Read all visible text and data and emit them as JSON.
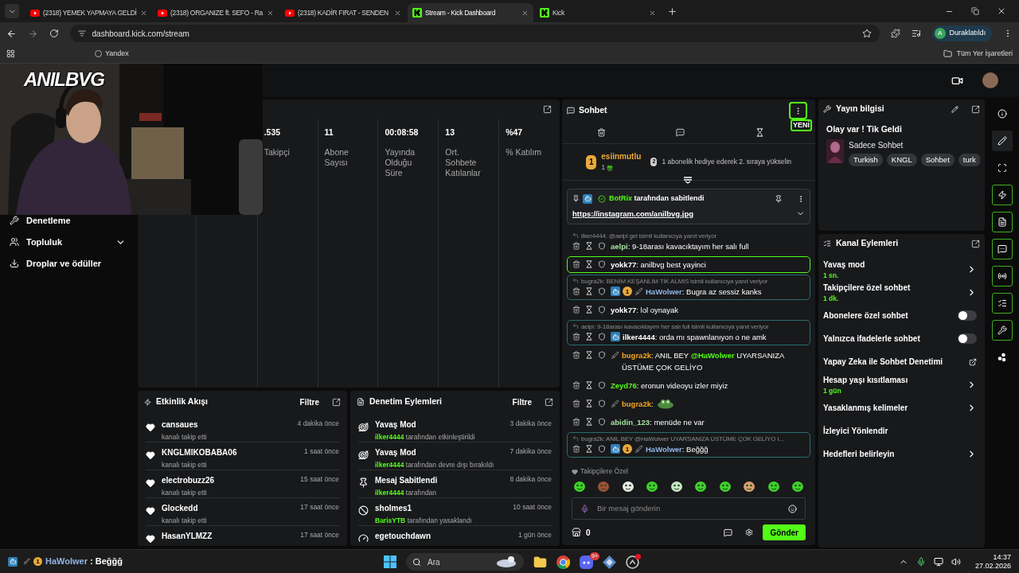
{
  "browser": {
    "tabs": [
      {
        "title": "(2318) YEMEK YAPMAYA GELDİ",
        "kind": "youtube",
        "selected": false
      },
      {
        "title": "(2318) ORGANIZE ft. SEFO - Ra",
        "kind": "youtube",
        "selected": false
      },
      {
        "title": "(2318) KADİR FIRAT - SENDEN",
        "kind": "youtube",
        "selected": false
      },
      {
        "title": "Stream - Kick Dashboard",
        "kind": "kick",
        "selected": true
      },
      {
        "title": "Kick",
        "kind": "kick",
        "selected": false
      }
    ],
    "url": "dashboard.kick.com/stream",
    "profile": {
      "initial": "A",
      "status": "Duraklatıldı"
    },
    "bookmarks": [
      "Yandex"
    ],
    "all_bookmarks": "Tüm Yer İşaretleri"
  },
  "overlay": {
    "logo": "ANILBVG",
    "chat_line": {
      "badge": "1",
      "user": "HaWolwer",
      "separator": ":",
      "text": "Beğğğ"
    }
  },
  "sidebar": {
    "items": [
      {
        "label": "Denetleme",
        "kind": "link"
      },
      {
        "label": "Topluluk",
        "kind": "expandable"
      },
      {
        "label": "Droplar ve ödüller",
        "kind": "link"
      }
    ]
  },
  "stats": [
    {
      "value": ".535",
      "label": "Takipçi"
    },
    {
      "value": "11",
      "label": "Abone Sayısı"
    },
    {
      "value": "00:08:58",
      "label": "Yayında Olduğu Süre"
    },
    {
      "value": "13",
      "label": "Ort. Sohbete Katılanlar"
    },
    {
      "value": "%47",
      "label": "% Katılım"
    }
  ],
  "activity_feed": {
    "title": "Etkinlik Akışı",
    "filter": "Filtre",
    "items": [
      {
        "name": "cansaues",
        "detail": "kanalı takip etti",
        "time": "4 dakika önce"
      },
      {
        "name": "KNGLMIKOBABA06",
        "detail": "kanalı takip etti",
        "time": "1 saat önce"
      },
      {
        "name": "electrobuzz26",
        "detail": "kanalı takip etti",
        "time": "15 saat önce"
      },
      {
        "name": "Glockedd",
        "detail": "kanalı takip etti",
        "time": "17 saat önce"
      },
      {
        "name": "HasanYLMZZ",
        "time": "17 saat önce"
      }
    ]
  },
  "moderation_log": {
    "title": "Denetim Eylemleri",
    "filter": "Filtre",
    "items": [
      {
        "kind": "slow",
        "title": "Yavaş Mod",
        "user": "ilker4444",
        "action": "tarafından etkinleştirildi",
        "time": "3 dakika önce"
      },
      {
        "kind": "slow",
        "title": "Yavaş Mod",
        "user": "ilker4444",
        "action": "tarafından devre dışı bırakıldı",
        "time": "7 dakika önce"
      },
      {
        "kind": "pin",
        "title": "Mesaj Sabitlendi",
        "user": "ilker4444",
        "action": "tarafından",
        "time": "8 dakika önce"
      },
      {
        "kind": "ban",
        "title": "sholmes1",
        "user": "BarisYTB",
        "action": "tarafından yasaklandı",
        "time": "10 saat önce"
      },
      {
        "kind": "gauge",
        "title": "egetouchdawn",
        "time": "1 gün önce"
      }
    ]
  },
  "chat": {
    "title": "Sohbet",
    "new_label": "YENİ",
    "separator": ":",
    "leader": {
      "rank": "1",
      "name": "esiinmutlu",
      "gifts": "1",
      "next_rank": "2",
      "hint": "1 abonelik hediye ederek 2. sıraya yükselin"
    },
    "pinned": {
      "user": "BotRix",
      "by": "tarafından sabitlendi",
      "link": "https://instagram.com/anilbvg.jpg"
    },
    "messages": [
      {
        "kind": "plain",
        "reply_to": "ilker4444: @aelpi gel isimli kullanıcıya yanıt veriyor",
        "user": "aelpi",
        "color": "#a6e3a1",
        "text": "9-18arası kavacıktayım her salı full"
      },
      {
        "kind": "highlighted",
        "user": "yokk77",
        "color": "#ffffff",
        "text": "anilbvg best yayinci"
      },
      {
        "kind": "reply",
        "reply_to": "bugra2k: BENİM KEŞANLIM TİK ALMIS isimli kullanıcıya yanıt veriyor",
        "badges": [
          {
            "kind": "bot"
          },
          {
            "kind": "sub",
            "label": "1"
          },
          {
            "kind": "sword"
          }
        ],
        "user": "HaWolwer",
        "color": "#8fb4e6",
        "text": "Bugra az sessiz kanks"
      },
      {
        "kind": "plain",
        "user": "yokk77",
        "color": "#ffffff",
        "text": "lol oynayak"
      },
      {
        "kind": "reply",
        "reply_to": "aelpi: 9-18arası kavacıktayım her salı full isimli kullanıcıya yanıt veriyor",
        "badges": [
          {
            "kind": "bot"
          }
        ],
        "user": "ilker4444",
        "color": "#ffffff",
        "text": "orda mı spawnlanıyon o ne amk"
      },
      {
        "kind": "plain",
        "badges": [
          {
            "kind": "sword"
          }
        ],
        "user": "bugra2k",
        "color": "#f5a623",
        "text": "ANIL BEY",
        "mention": "@HaWolwer",
        "text_after": "UYARSANIZA ÜSTÜME ÇOK GELİYO"
      },
      {
        "kind": "plain",
        "user": "Zeyd76",
        "color": "#53fc18",
        "text": "eronun videoyu izler miyiz"
      },
      {
        "kind": "plain",
        "badges": [
          {
            "kind": "sword"
          }
        ],
        "user": "bugra2k",
        "color": "#f5a623",
        "emote": true
      },
      {
        "kind": "plain",
        "user": "abidin_123",
        "color": "#a6e3a1",
        "text": "menüde ne var"
      },
      {
        "kind": "reply",
        "reply_to": "bugra2k: ANIL BEY @HaWolwer UYARSANIZA ÜSTÜME ÇOK GELİYO I...",
        "badges": [
          {
            "kind": "bot"
          },
          {
            "kind": "sub",
            "label": "1"
          },
          {
            "kind": "sword"
          }
        ],
        "user": "HaWolwer",
        "color": "#8fb4e6",
        "text": "Beğğğ"
      }
    ],
    "emote_label": "Takipçilere Özel",
    "placeholder": "Bir mesaj gönderin",
    "store_count": "0",
    "send": "Gönder"
  },
  "stream_info": {
    "title": "Yayın bilgisi",
    "stream_title": "Olay var ! Tik Geldi",
    "category": "Sadece Sohbet",
    "tags": [
      "Turkish",
      "KNGL",
      "Sohbet",
      "turk"
    ]
  },
  "channel_actions": {
    "title": "Kanal Eylemleri",
    "items": [
      {
        "kind": "arrow",
        "label": "Yavaş mod",
        "value": "1 sn."
      },
      {
        "kind": "arrow",
        "label": "Takipçilere özel sohbet",
        "value": "1 dk."
      },
      {
        "kind": "toggle",
        "label": "Abonelere özel sohbet",
        "on": false
      },
      {
        "kind": "toggle",
        "label": "Yalnızca ifadelerle sohbet",
        "on": false
      },
      {
        "kind": "external",
        "label": "Yapay Zeka ile Sohbet Denetimi"
      },
      {
        "kind": "arrow",
        "label": "Hesap yaşı kısıtlaması",
        "value": "1 gün"
      },
      {
        "kind": "arrow",
        "label": "Yasaklanmış kelimeler"
      },
      {
        "kind": "plain",
        "label": "İzleyici Yönlendir"
      },
      {
        "kind": "arrow",
        "label": "Hedefleri belirleyin"
      }
    ]
  },
  "rail": [
    {
      "kind": "info",
      "highlighted": false,
      "selected": false
    },
    {
      "kind": "pencil",
      "highlighted": false,
      "selected": true
    },
    {
      "kind": "focus",
      "highlighted": false,
      "selected": false
    },
    {
      "kind": "bolt",
      "highlighted": true,
      "selected": false
    },
    {
      "kind": "document",
      "highlighted": true,
      "selected": false
    },
    {
      "kind": "chat",
      "highlighted": true,
      "selected": false
    },
    {
      "kind": "broadcast",
      "highlighted": true,
      "selected": false
    },
    {
      "kind": "actions",
      "highlighted": true,
      "selected": false
    },
    {
      "kind": "wrench",
      "highlighted": true,
      "selected": false
    },
    {
      "kind": "dots",
      "highlighted": false,
      "selected": false
    }
  ],
  "taskbar": {
    "search": "Ara",
    "discord_badge": "9+",
    "time": "14:37",
    "date": "27.02.2026"
  }
}
